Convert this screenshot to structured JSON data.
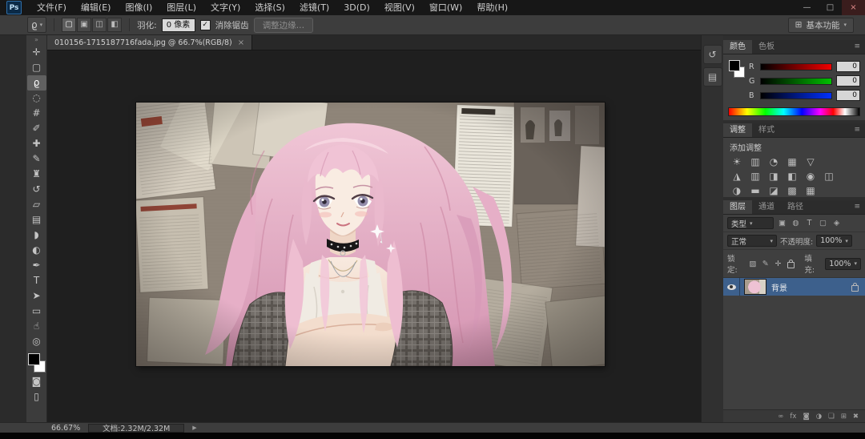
{
  "colors": {
    "selection_highlight": "#3d608c",
    "panel_background": "#3f3f3f",
    "canvas_background": "#1f1f1f",
    "titlebar_background": "#171717"
  },
  "titlebar": {
    "logo": "Ps",
    "menus": [
      "文件(F)",
      "编辑(E)",
      "图像(I)",
      "图层(L)",
      "文字(Y)",
      "选择(S)",
      "滤镜(T)",
      "3D(D)",
      "视图(V)",
      "窗口(W)",
      "帮助(H)"
    ],
    "window": {
      "minimize": "—",
      "restore": "□",
      "close": "×"
    }
  },
  "options": {
    "tool_icon": "ϱ",
    "modes": [
      "▢",
      "▣",
      "◫",
      "◧"
    ],
    "feather_label": "羽化:",
    "feather_value": "0 像素",
    "antialias_check": "✓",
    "antialias_label": "消除锯齿",
    "refine_edge": "调整边缘…",
    "workspace_icon": "⊞",
    "workspace": "基本功能"
  },
  "doc_tab": {
    "title": "010156-1715187716fada.jpg @ 66.7%(RGB/8)",
    "close": "×"
  },
  "tools": {
    "grip": "»",
    "items": [
      {
        "name": "move",
        "glyph": "✛"
      },
      {
        "name": "marquee",
        "glyph": "▢"
      },
      {
        "name": "lasso",
        "glyph": "ϱ"
      },
      {
        "name": "quick-selection",
        "glyph": "◌"
      },
      {
        "name": "crop",
        "glyph": "#"
      },
      {
        "name": "eyedropper",
        "glyph": "✐"
      },
      {
        "name": "healing-brush",
        "glyph": "✚"
      },
      {
        "name": "brush",
        "glyph": "✎"
      },
      {
        "name": "clone-stamp",
        "glyph": "♜"
      },
      {
        "name": "history-brush",
        "glyph": "↺"
      },
      {
        "name": "eraser",
        "glyph": "▱"
      },
      {
        "name": "gradient",
        "glyph": "▤"
      },
      {
        "name": "blur",
        "glyph": "◗"
      },
      {
        "name": "dodge",
        "glyph": "◐"
      },
      {
        "name": "pen",
        "glyph": "✒"
      },
      {
        "name": "type",
        "glyph": "T"
      },
      {
        "name": "path-selection",
        "glyph": "➤"
      },
      {
        "name": "shape",
        "glyph": "▭"
      },
      {
        "name": "hand",
        "glyph": "☝"
      },
      {
        "name": "zoom",
        "glyph": "◎"
      }
    ],
    "extras": [
      {
        "name": "quick-mask",
        "glyph": "◙"
      },
      {
        "name": "screen-mode",
        "glyph": "▯"
      }
    ]
  },
  "collapsed_panels": [
    {
      "name": "history",
      "glyph": "↺"
    },
    {
      "name": "properties",
      "glyph": "▤"
    }
  ],
  "color_panel": {
    "tabs": [
      "颜色",
      "色板"
    ],
    "menu_icon": "≡",
    "channels": [
      {
        "label": "R",
        "value": "0"
      },
      {
        "label": "G",
        "value": "0"
      },
      {
        "label": "B",
        "value": "0"
      }
    ]
  },
  "adjustments_panel": {
    "tabs": [
      "调整",
      "样式"
    ],
    "menu_icon": "≡",
    "add_label": "添加调整",
    "rows": [
      [
        "☀",
        "▥",
        "◔",
        "▦",
        "▽"
      ],
      [
        "◮",
        "▥",
        "◨",
        "◧",
        "◉",
        "◫"
      ],
      [
        "◑",
        "▬",
        "◪",
        "▩",
        "▦"
      ]
    ]
  },
  "layers_panel": {
    "tabs": [
      "图层",
      "通道",
      "路径"
    ],
    "menu_icon": "≡",
    "filter_label": "类型",
    "filter_icons": [
      "▣",
      "◍",
      "T",
      "▢",
      "◈"
    ],
    "blend_mode": "正常",
    "opacity_label": "不透明度:",
    "opacity_value": "100%",
    "lock_label": "锁定:",
    "lock_icons": [
      "▨",
      "✎",
      "✛"
    ],
    "fill_label": "填充:",
    "fill_value": "100%",
    "layer": {
      "name": "背景"
    },
    "footer_icons": [
      "∞",
      "fx",
      "◙",
      "◑",
      "❏",
      "⊞",
      "✖"
    ]
  },
  "statusbar": {
    "zoom": "66.67%",
    "doc_info": "文档:2.32M/2.32M",
    "flyout": "▶"
  },
  "ui": {
    "dropdown": "▾"
  }
}
